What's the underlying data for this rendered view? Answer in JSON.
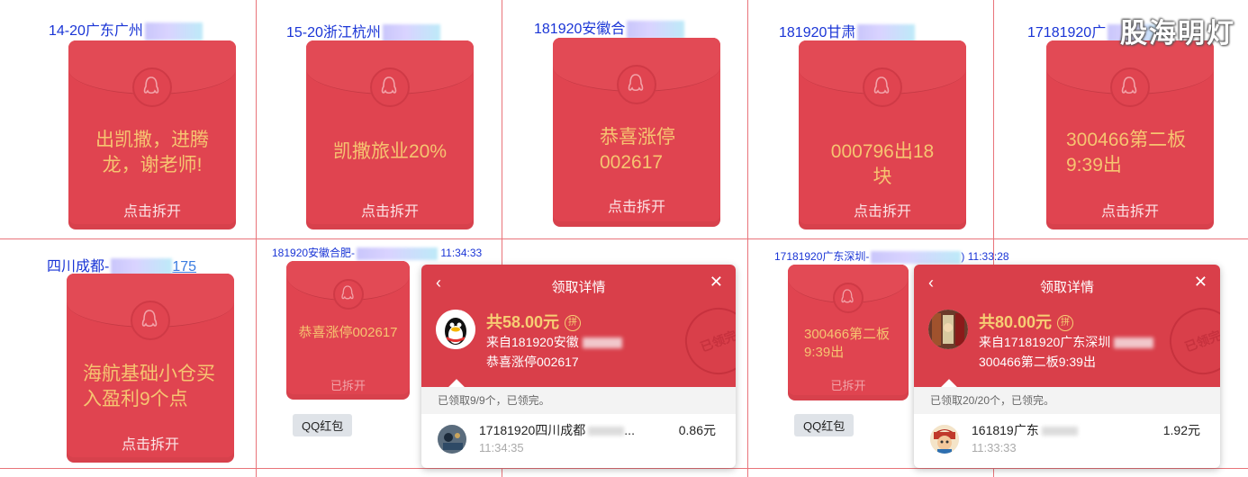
{
  "watermark": "股海明灯",
  "row1": [
    {
      "caption": "14-20广东广州",
      "message": "出凯撒，进腾龙，谢老师!",
      "open": "点击拆开"
    },
    {
      "caption": "15-20浙江杭州",
      "message": "凯撒旅业20%",
      "open": "点击拆开"
    },
    {
      "caption": "181920安徽合",
      "message": "恭喜涨停002617",
      "open": "点击拆开"
    },
    {
      "caption": "181920甘肃",
      "message": "000796出18块",
      "open": "点击拆开"
    },
    {
      "caption": "17181920广",
      "message": "300466第二板9:39出",
      "open": "点击拆开"
    }
  ],
  "row2": {
    "cell1": {
      "caption": "四川成都-",
      "caption_tail": "175",
      "message": "海航基础小仓买入盈利9个点",
      "open": "点击拆开"
    },
    "cell2": {
      "header_left": "181920安徽合肥-",
      "header_time": "11:34:33",
      "envelope_msg": "恭喜涨停002617",
      "envelope_open": "已拆开",
      "tag": "QQ红包",
      "popup": {
        "back": "‹",
        "title": "领取详情",
        "close": "✕",
        "amount": "共58.00元",
        "pin": "拼",
        "from": "来自181920安徽",
        "note": "恭喜涨停002617",
        "stamp": "已领完",
        "status": "已领取9/9个，已领完。",
        "row_name": "17181920四川成都",
        "row_name_tail": "...",
        "row_time": "11:34:35",
        "row_amount": "0.86元"
      }
    },
    "cell3": {
      "header_left": "17181920广东深圳-",
      "header_time": "11:33:28",
      "envelope_msg": "300466第二板9:39出",
      "envelope_open": "已拆开",
      "tag": "QQ红包",
      "popup": {
        "back": "‹",
        "title": "领取详情",
        "close": "✕",
        "amount": "共80.00元",
        "pin": "拼",
        "from": "来自17181920广东深圳",
        "note": "300466第二板9:39出",
        "stamp": "已领完",
        "status": "已领取20/20个，已领完。",
        "row_name": "161819广东",
        "row_name_tail": "",
        "row_time": "11:33:33",
        "row_amount": "1.92元"
      }
    }
  }
}
